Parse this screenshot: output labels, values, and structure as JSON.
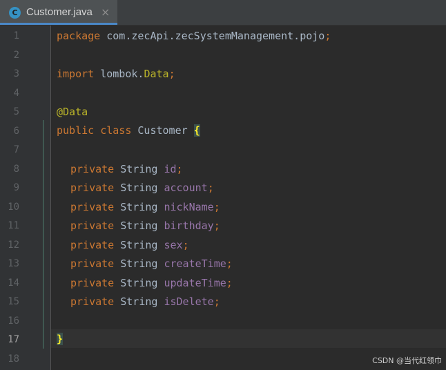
{
  "tab": {
    "icon_letter": "C",
    "label": "Customer.java",
    "close_glyph": "×"
  },
  "line_numbers": [
    "1",
    "2",
    "3",
    "4",
    "5",
    "6",
    "7",
    "8",
    "9",
    "10",
    "11",
    "12",
    "13",
    "14",
    "15",
    "16",
    "17",
    "18"
  ],
  "current_line": "17",
  "code": {
    "l1_kw": "package",
    "l1_text": " com.zecApi.zecSystemManagement.pojo",
    "l1_semi": ";",
    "l3_kw": "import",
    "l3_text": " lombok.",
    "l3_type": "Data",
    "l3_semi": ";",
    "l5_ann": "@Data",
    "l6_kw": "public class",
    "l6_text": " Customer ",
    "l6_brace": "{",
    "fields": [
      {
        "kw": "private",
        "type": " String ",
        "name": "id",
        "semi": ";"
      },
      {
        "kw": "private",
        "type": " String ",
        "name": "account",
        "semi": ";"
      },
      {
        "kw": "private",
        "type": " String ",
        "name": "nickName",
        "semi": ";"
      },
      {
        "kw": "private",
        "type": " String ",
        "name": "birthday",
        "semi": ";"
      },
      {
        "kw": "private",
        "type": " String ",
        "name": "sex",
        "semi": ";"
      },
      {
        "kw": "private",
        "type": " String ",
        "name": "createTime",
        "semi": ";"
      },
      {
        "kw": "private",
        "type": " String ",
        "name": "updateTime",
        "semi": ";"
      },
      {
        "kw": "private",
        "type": " String ",
        "name": "isDelete",
        "semi": ";"
      }
    ],
    "l17_brace": "}"
  },
  "watermark": "CSDN @当代红领巾",
  "colors": {
    "keyword": "#cc7832",
    "annotation": "#bbb529",
    "field": "#9876aa",
    "text": "#a9b7c6",
    "background": "#2b2b2b"
  }
}
